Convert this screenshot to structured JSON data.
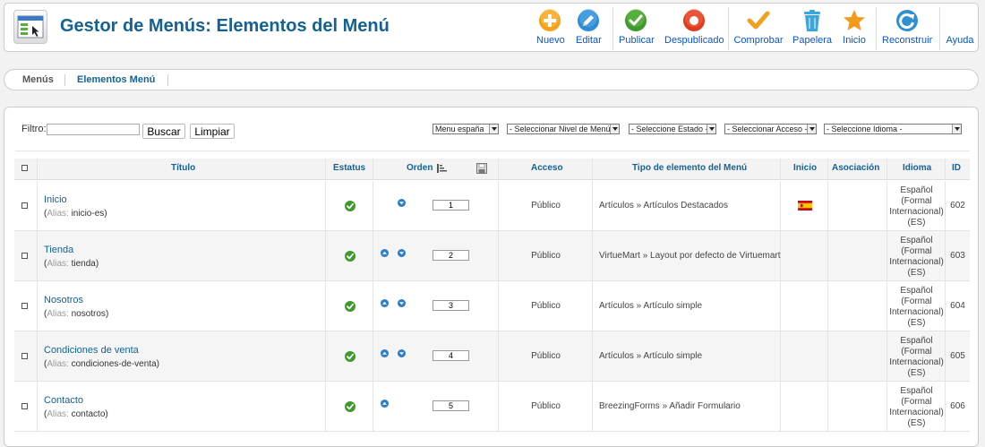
{
  "header": {
    "title": "Gestor de Menús: Elementos del Menú",
    "logo_icon": "menu-manager-icon"
  },
  "toolbar": [
    {
      "id": "new",
      "label": "Nuevo",
      "icon": "plus-circle-icon",
      "color": "#f7a11a"
    },
    {
      "id": "edit",
      "label": "Editar",
      "icon": "pencil-icon",
      "color": "#2e8bd8"
    },
    {
      "id": "publish",
      "label": "Publicar",
      "icon": "check-circle-icon",
      "color": "#3e9a2a"
    },
    {
      "id": "unpublish",
      "label": "Despublicado",
      "icon": "stop-circle-icon",
      "color": "#e03b1f"
    },
    {
      "id": "checkin",
      "label": "Comprobar",
      "icon": "checkmark-icon",
      "color": "#f0a11e"
    },
    {
      "id": "trash",
      "label": "Papelera",
      "icon": "trash-icon",
      "color": "#3ba6dd"
    },
    {
      "id": "home",
      "label": "Inicio",
      "icon": "star-icon",
      "color": "#f49a1a"
    },
    {
      "id": "rebuild",
      "label": "Reconstruir",
      "icon": "refresh-icon",
      "color": "#2f90d4"
    },
    {
      "id": "help",
      "label": "Ayuda",
      "icon": "help-icon",
      "color": "#2f6fa8"
    }
  ],
  "submenu": {
    "tabs": [
      {
        "label": "Menús",
        "active": false
      },
      {
        "label": "Elementos Menú",
        "active": true
      }
    ]
  },
  "filters": {
    "label": "Filtro:",
    "search_value": "",
    "search_button": "Buscar",
    "clear_button": "Limpiar",
    "dropdowns": [
      "Menu españa",
      "- Seleccionar Nivel de Menú -",
      "- Seleccione Estado -",
      "- Seleccionar Acceso -",
      "- Seleccione Idioma -"
    ]
  },
  "table": {
    "headers": {
      "title": "Título",
      "status": "Estatus",
      "order": "Orden",
      "access": "Acceso",
      "type": "Tipo de elemento del Menú",
      "home": "Inicio",
      "association": "Asociación",
      "language": "Idioma",
      "id": "ID"
    },
    "alias_label": "Alias:",
    "rows": [
      {
        "title": "Inicio",
        "alias": "inicio-es",
        "order": "1",
        "up": false,
        "down": true,
        "access": "Público",
        "type": "Artículos » Artículos Destacados",
        "home": true,
        "language": "Español (Formal Internacional) (ES)",
        "id": "602"
      },
      {
        "title": "Tienda",
        "alias": "tienda",
        "order": "2",
        "up": true,
        "down": true,
        "access": "Público",
        "type": "VirtueMart » Layout por defecto de Virtuemart",
        "home": false,
        "language": "Español (Formal Internacional) (ES)",
        "id": "603"
      },
      {
        "title": "Nosotros",
        "alias": "nosotros",
        "order": "3",
        "up": true,
        "down": true,
        "access": "Público",
        "type": "Artículos » Artículo simple",
        "home": false,
        "language": "Español (Formal Internacional) (ES)",
        "id": "604"
      },
      {
        "title": "Condiciones de venta",
        "alias": "condiciones-de-venta",
        "order": "4",
        "up": true,
        "down": true,
        "access": "Público",
        "type": "Artículos » Artículo simple",
        "home": false,
        "language": "Español (Formal Internacional) (ES)",
        "id": "605"
      },
      {
        "title": "Contacto",
        "alias": "contacto",
        "order": "5",
        "up": true,
        "down": false,
        "access": "Público",
        "type": "BreezingForms » Añadir Formulario",
        "home": false,
        "language": "Español (Formal Internacional) (ES)",
        "id": "606"
      }
    ]
  },
  "colors": {
    "title_blue": "#146295",
    "link_blue": "#0b55c4",
    "published_green": "#3e9a2a",
    "order_blue": "#2c7ec9"
  }
}
